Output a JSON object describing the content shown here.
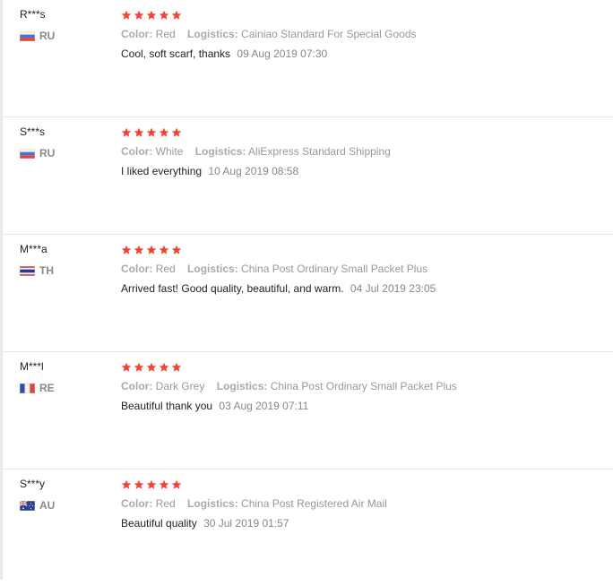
{
  "colors": {
    "star": "#f44336",
    "divider": "#e6e6e6",
    "muted": "#999999"
  },
  "labels": {
    "color": "Color:",
    "logistics": "Logistics:"
  },
  "reviews": [
    {
      "user": "R***s",
      "country": "RU",
      "flag_icon": "russia-flag-icon",
      "rating": 5,
      "color": "Red",
      "logistics": "Cainiao Standard For Special Goods",
      "text": "Cool, soft scarf, thanks",
      "time": "09 Aug 2019 07:30"
    },
    {
      "user": "S***s",
      "country": "RU",
      "flag_icon": "russia-flag-icon",
      "rating": 5,
      "color": "White",
      "logistics": "AliExpress Standard Shipping",
      "text": "I liked everything",
      "time": "10 Aug 2019 08:58"
    },
    {
      "user": "M***a",
      "country": "TH",
      "flag_icon": "thailand-flag-icon",
      "rating": 5,
      "color": "Red",
      "logistics": "China Post Ordinary Small Packet Plus",
      "text": "Arrived fast! Good quality, beautiful, and warm.",
      "time": "04 Jul 2019 23:05"
    },
    {
      "user": "M***l",
      "country": "RE",
      "flag_icon": "reunion-flag-icon",
      "rating": 5,
      "color": "Dark Grey",
      "logistics": "China Post Ordinary Small Packet Plus",
      "text": "Beautiful thank you",
      "time": "03 Aug 2019 07:11"
    },
    {
      "user": "S***y",
      "country": "AU",
      "flag_icon": "australia-flag-icon",
      "rating": 5,
      "color": "Red",
      "logistics": "China Post Registered Air Mail",
      "text": "Beautiful quality",
      "time": "30 Jul 2019 01:57"
    }
  ]
}
